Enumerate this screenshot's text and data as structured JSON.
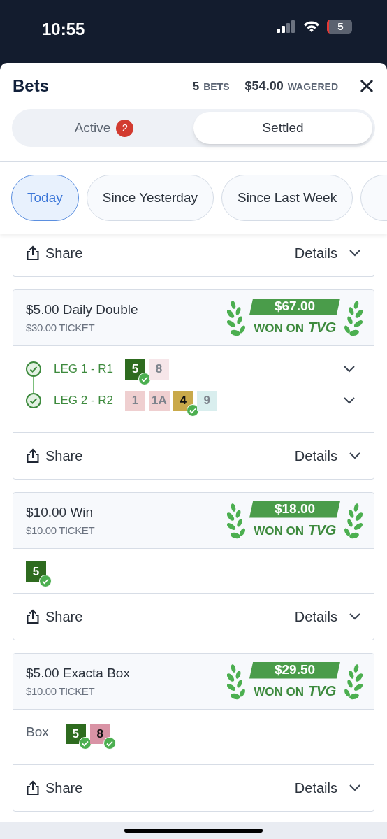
{
  "status_bar": {
    "time": "10:55",
    "battery": "5"
  },
  "header": {
    "title": "Bets",
    "bet_count": "5",
    "bet_count_label": "BETS",
    "wagered": "$54.00",
    "wagered_label": "WAGERED"
  },
  "tabs": [
    {
      "label": "Active",
      "badge": "2",
      "selected": false
    },
    {
      "label": "Settled",
      "selected": true
    }
  ],
  "filters": [
    {
      "label": "Today",
      "selected": true
    },
    {
      "label": "Since Yesterday",
      "selected": false
    },
    {
      "label": "Since Last Week",
      "selected": false
    }
  ],
  "partial_card": {
    "share": "Share",
    "details": "Details"
  },
  "bets": [
    {
      "kind": "legs",
      "title": "$5.00 Daily Double",
      "ticket": "$30.00 TICKET",
      "won": "$67.00",
      "won_label": "WON ON",
      "brand": "TVG",
      "share": "Share",
      "details": "Details",
      "legs": [
        {
          "label": "LEG 1 - R1",
          "checked": true,
          "expanded": false,
          "runners": [
            {
              "number": "5",
              "color": "#2e6b1f",
              "won": true
            },
            {
              "number": "8",
              "color": "#f6e6e9",
              "won": false
            }
          ]
        },
        {
          "label": "LEG 2 - R2",
          "checked": true,
          "expanded": false,
          "runners": [
            {
              "number": "1",
              "color": "#efcfd0",
              "won": false
            },
            {
              "number": "1A",
              "color": "#efcfd0",
              "won": false
            },
            {
              "number": "4",
              "color": "#c9a94a",
              "won": true
            },
            {
              "number": "9",
              "color": "#d9eeee",
              "won": false
            }
          ]
        }
      ]
    },
    {
      "kind": "selections",
      "title": "$10.00 Win",
      "ticket": "$10.00 TICKET",
      "won": "$18.00",
      "won_label": "WON ON",
      "brand": "TVG",
      "share": "Share",
      "details": "Details",
      "runners": [
        {
          "number": "5",
          "color": "#2e6b1f",
          "won": true
        }
      ]
    },
    {
      "kind": "selections",
      "title": "$5.00 Exacta Box",
      "ticket": "$10.00 TICKET",
      "won": "$29.50",
      "won_label": "WON ON",
      "brand": "TVG",
      "share": "Share",
      "details": "Details",
      "label": "Box",
      "runners": [
        {
          "number": "5",
          "color": "#2e6b1f",
          "won": true
        },
        {
          "number": "8",
          "color": "#d993a5",
          "won": true
        }
      ]
    }
  ]
}
